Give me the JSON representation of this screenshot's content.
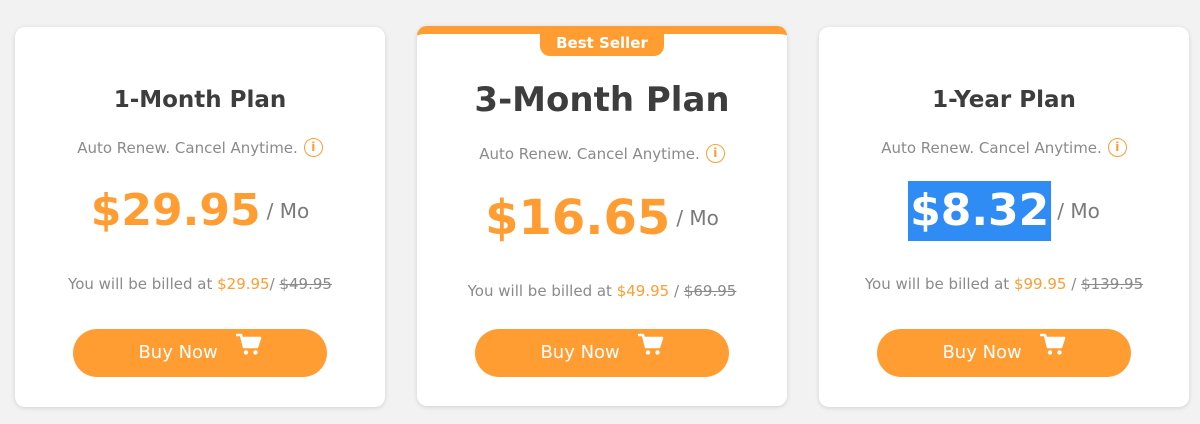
{
  "plans": [
    {
      "title": "1-Month Plan",
      "subtitle": "Auto Renew. Cancel Anytime.",
      "info_icon": "i",
      "price": "$29.95",
      "per": "/ Mo",
      "billed_text": "You will be billed at",
      "billed_amount": "$29.95",
      "separator": "/",
      "original_amount": "$49.95",
      "button_label": "Buy Now"
    },
    {
      "badge": "Best Seller",
      "title": "3-Month Plan",
      "subtitle": "Auto Renew. Cancel Anytime.",
      "info_icon": "i",
      "price": "$16.65",
      "per": "/ Mo",
      "billed_text": "You will be billed at",
      "billed_amount": "$49.95",
      "separator": "/",
      "original_amount": "$69.95",
      "button_label": "Buy Now"
    },
    {
      "title": "1-Year Plan",
      "subtitle": "Auto Renew. Cancel Anytime.",
      "info_icon": "i",
      "price": "$8.32",
      "per": "/ Mo",
      "billed_text": "You will be billed at",
      "billed_amount": "$99.95",
      "separator": "/",
      "original_amount": "$139.95",
      "button_label": "Buy Now"
    }
  ],
  "colors": {
    "accent": "#ff9d33",
    "selection": "#2f8cf5",
    "background": "#f2f2f2",
    "card": "#ffffff",
    "title_text": "#3d3d3d",
    "muted_text": "#8a8a8a"
  }
}
